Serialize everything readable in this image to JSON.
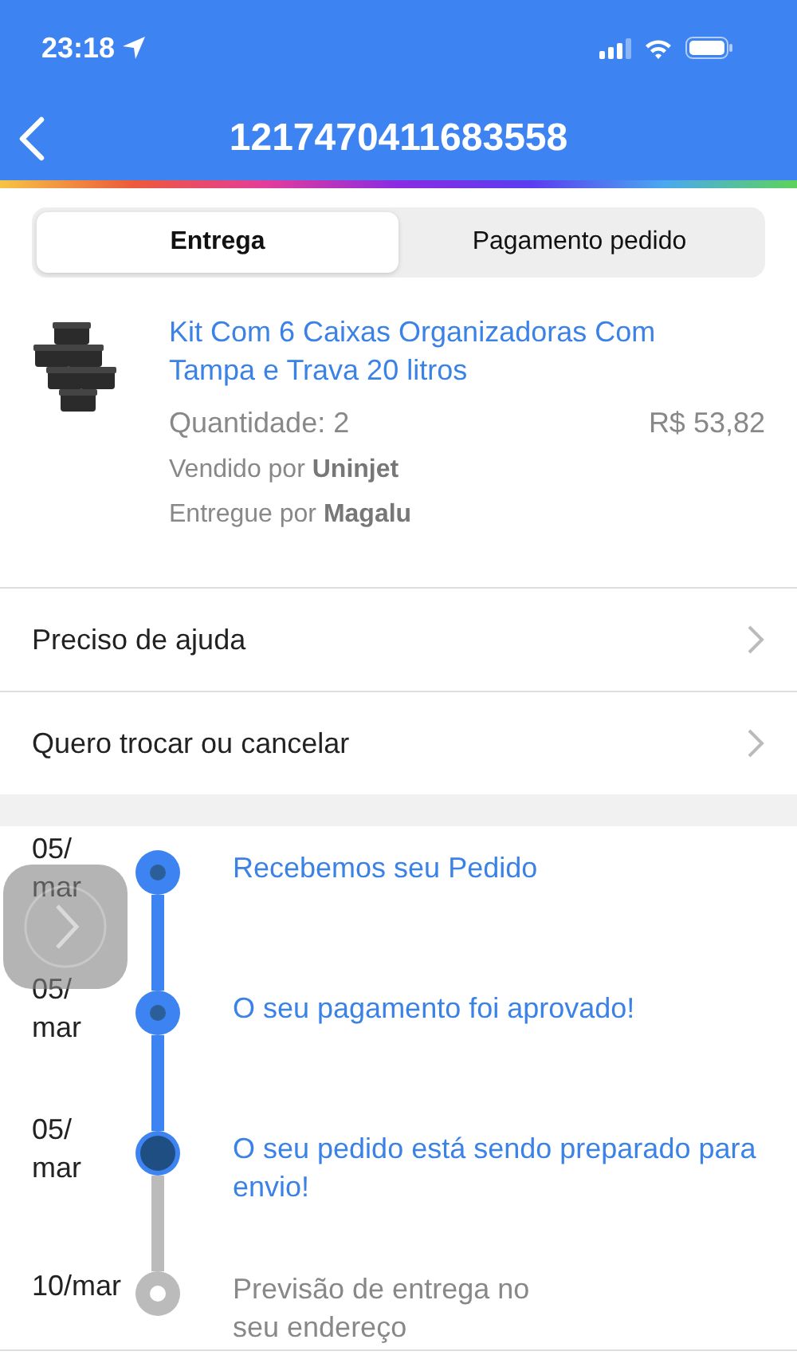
{
  "status_bar": {
    "time": "23:18"
  },
  "nav": {
    "title": "1217470411683558"
  },
  "tabs": [
    {
      "label": "Entrega",
      "selected": true
    },
    {
      "label": "Pagamento pedido",
      "selected": false
    }
  ],
  "product": {
    "kind": "picture",
    "name": "Kit Com 6 Caixas Organizadoras Com Tampa e Trava 20 litros",
    "quantity": "Quantidade: 2",
    "price": "R$ 53,82",
    "sold_by": "Vendido por **Uninjet**",
    "delivered_by": "Entregue por **Magalu**"
  },
  "actions": [
    {
      "label": "Preciso de ajuda"
    },
    {
      "label": "Quero trocar ou cancelar"
    }
  ],
  "timeline": [
    {
      "date": "05/ mar",
      "text": "Recebemos seu Pedido",
      "done": true,
      "current": false
    },
    {
      "date": "05/ mar",
      "text": "O seu pagamento foi aprovado!",
      "done": true,
      "current": false
    },
    {
      "date": "05/ mar",
      "text": "O seu pedido está sendo preparado para envio!",
      "done": true,
      "current": true
    },
    {
      "date": "10/mar",
      "text": "Previsão de entrega no seu endereço",
      "done": false,
      "current": false
    }
  ]
}
